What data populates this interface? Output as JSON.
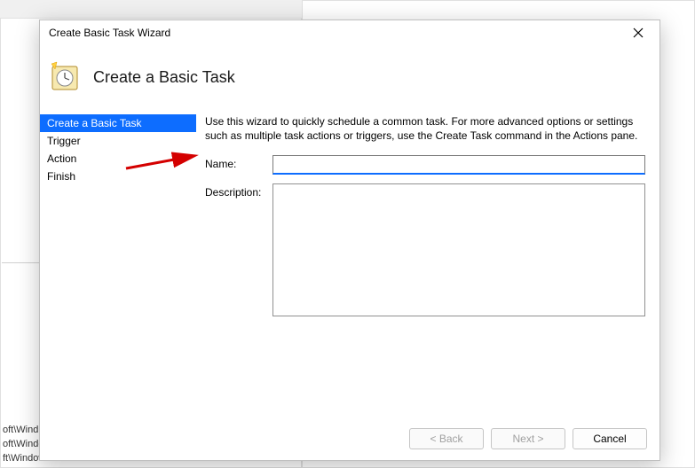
{
  "background": {
    "snippets": [
      "oft\\Wind...",
      "oft\\Windows\\U...",
      "ft\\Windows\\ Fl..."
    ]
  },
  "dialog": {
    "title": "Create Basic Task Wizard",
    "page_title": "Create a Basic Task",
    "nav": {
      "items": [
        {
          "label": "Create a Basic Task",
          "selected": true
        },
        {
          "label": "Trigger",
          "selected": false
        },
        {
          "label": "Action",
          "selected": false
        },
        {
          "label": "Finish",
          "selected": false
        }
      ]
    },
    "instruction": "Use this wizard to quickly schedule a common task.  For more advanced options or settings such as multiple task actions or triggers, use the Create Task command in the Actions pane.",
    "form": {
      "name_label": "Name:",
      "name_value": "",
      "description_label": "Description:",
      "description_value": ""
    },
    "buttons": {
      "back": "< Back",
      "next": "Next >",
      "cancel": "Cancel"
    }
  }
}
